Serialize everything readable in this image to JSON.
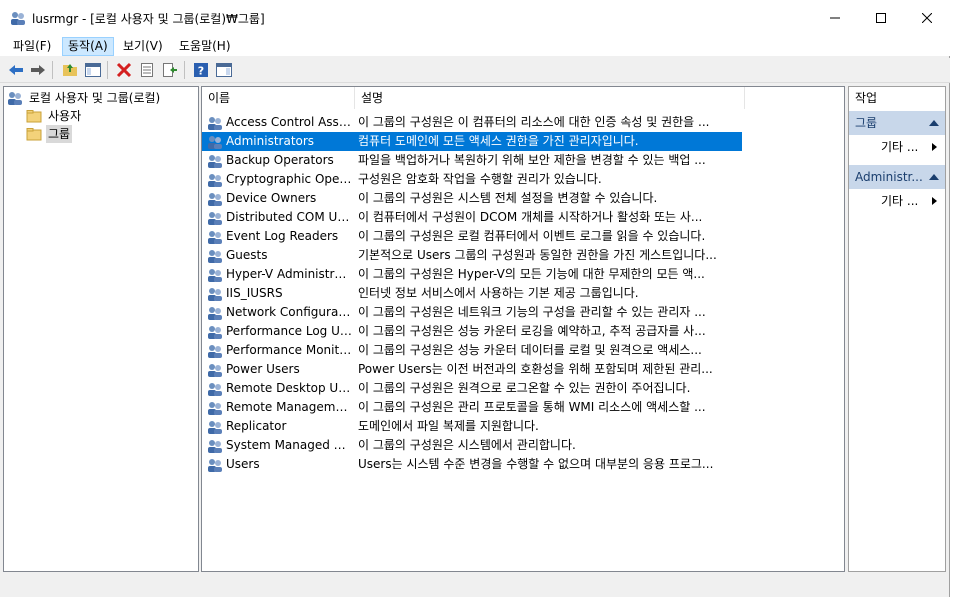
{
  "window": {
    "title": "lusrmgr - [로컬 사용자 및 그룹(로컬)₩그룹]",
    "accent": "#0078d7"
  },
  "menu": {
    "items": [
      {
        "label": "파일(F)"
      },
      {
        "label": "동작(A)"
      },
      {
        "label": "보기(V)"
      },
      {
        "label": "도움말(H)"
      }
    ]
  },
  "toolbar": {
    "buttons": [
      "back-arrow-icon",
      "forward-arrow-icon",
      "up-folder-icon",
      "show-hide-tree-icon",
      "delete-icon",
      "properties-icon",
      "export-list-icon",
      "help-icon",
      "show-hide-action-pane-icon"
    ]
  },
  "tree": {
    "root": "로컬 사용자 및 그룹(로컬)",
    "children": [
      {
        "label": "사용자"
      },
      {
        "label": "그룹"
      }
    ]
  },
  "list": {
    "headers": {
      "name": "이름",
      "description": "설명"
    },
    "rows": [
      {
        "name": "Access Control Assist...",
        "description": "이 그룹의 구성원은 이 컴퓨터의 리소스에 대한 인증 속성 및 권한을 ..."
      },
      {
        "name": "Administrators",
        "description": "컴퓨터 도메인에 모든 액세스 권한을 가진 관리자입니다."
      },
      {
        "name": "Backup Operators",
        "description": "파일을 백업하거나 복원하기 위해 보안 제한을 변경할 수 있는 백업 ..."
      },
      {
        "name": "Cryptographic Operat...",
        "description": "구성원은 암호화 작업을 수행할 권리가 있습니다."
      },
      {
        "name": "Device Owners",
        "description": "이 그룹의 구성원은 시스템 전체 설정을 변경할 수 있습니다."
      },
      {
        "name": "Distributed COM Users",
        "description": "이 컴퓨터에서 구성원이 DCOM 개체를 시작하거나 활성화 또는 사..."
      },
      {
        "name": "Event Log Readers",
        "description": "이 그룹의 구성원은 로컬 컴퓨터에서 이벤트 로그를 읽을 수 있습니다."
      },
      {
        "name": "Guests",
        "description": "기본적으로 Users 그룹의 구성원과 동일한 권한을 가진 게스트입니다..."
      },
      {
        "name": "Hyper-V Administrat...",
        "description": "이 그룹의 구성원은 Hyper-V의 모든 기능에 대한 무제한의 모든 액..."
      },
      {
        "name": "IIS_IUSRS",
        "description": "인터넷 정보 서비스에서 사용하는 기본 제공 그룹입니다."
      },
      {
        "name": "Network Configuratio...",
        "description": "이 그룹의 구성원은 네트워크 기능의 구성을 관리할 수 있는 관리자 ..."
      },
      {
        "name": "Performance Log Users",
        "description": "이 그룹의 구성원은 성능 카운터 로깅을 예약하고, 추적 공급자를 사..."
      },
      {
        "name": "Performance Monitor...",
        "description": "이 그룹의 구성원은 성능 카운터 데이터를 로컬 및 원격으로 액세스..."
      },
      {
        "name": "Power Users",
        "description": "Power Users는 이전 버전과의 호환성을 위해 포함되며 제한된 관리..."
      },
      {
        "name": "Remote Desktop Users",
        "description": "이 그룹의 구성원은 원격으로 로그온할 수 있는 권한이 주어집니다."
      },
      {
        "name": "Remote Management...",
        "description": "이 그룹의 구성원은 관리 프로토콜을 통해 WMI 리소스에 액세스할 ..."
      },
      {
        "name": "Replicator",
        "description": "도메인에서 파일 복제를 지원합니다."
      },
      {
        "name": "System Managed Acc...",
        "description": "이 그룹의 구성원은 시스템에서 관리합니다."
      },
      {
        "name": "Users",
        "description": "Users는 시스템 수준 변경을 수행할 수 없으며 대부분의 응용 프로그..."
      }
    ]
  },
  "actions": {
    "header": "작업",
    "sections": [
      {
        "title": "그룹",
        "item": "기타 ..."
      },
      {
        "title": "Administr...",
        "item": "기타 ..."
      }
    ]
  }
}
